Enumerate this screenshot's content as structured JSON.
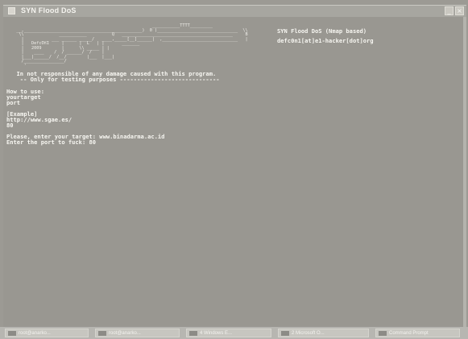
{
  "window": {
    "title": "SYN Flood DoS",
    "title_icon": "console-icon"
  },
  "console": {
    "banner": [
      "                                                        ___________TTTT_________",
      "  __,_______________________________________________)  0 )________________________________  \\\\",
      "   \\\\              ___________          Q   ____________________________________________     B",
      "    |       ___ ___ ______ _____/   ____,_____[__]______|  ,______________________________   |",
      "    |   DefcOn1     |      |  L   | |       _______",
      "    |   2009        |      \\\\ _____ | |",
      "    |    ____    /  / ______/  /    |",
      "    |___|______/  /__/        |___  |___|",
      "    /________________/",
      "     '"
    ],
    "tool_name": "SYN Flood DoS (Nmap based)",
    "contact": "defc0n1[at]e1-hacker[dot]org",
    "disclaimer": "  In not responsible of any damage caused with this program.",
    "testing": "   -- Only for testing purposes -----------------------------",
    "how_to": [
      "How to use:",
      "yourtarget",
      "port"
    ],
    "example": [
      "[Example]",
      "http://www.sgae.es/",
      "80"
    ],
    "prompts": [
      "Please, enter your target: www.binadarma.ac.id",
      "Enter the port to fuck: 80"
    ]
  },
  "taskbar": {
    "items": [
      {
        "label": "root@anarko...",
        "icon": "terminal-icon"
      },
      {
        "label": "root@anarko...",
        "icon": "terminal-icon"
      },
      {
        "label": "4 Windows E...",
        "icon": "folder-icon"
      },
      {
        "label": "2 Microsoft O...",
        "icon": "office-icon"
      },
      {
        "label": "Command Prompt",
        "icon": "console-icon"
      }
    ]
  }
}
